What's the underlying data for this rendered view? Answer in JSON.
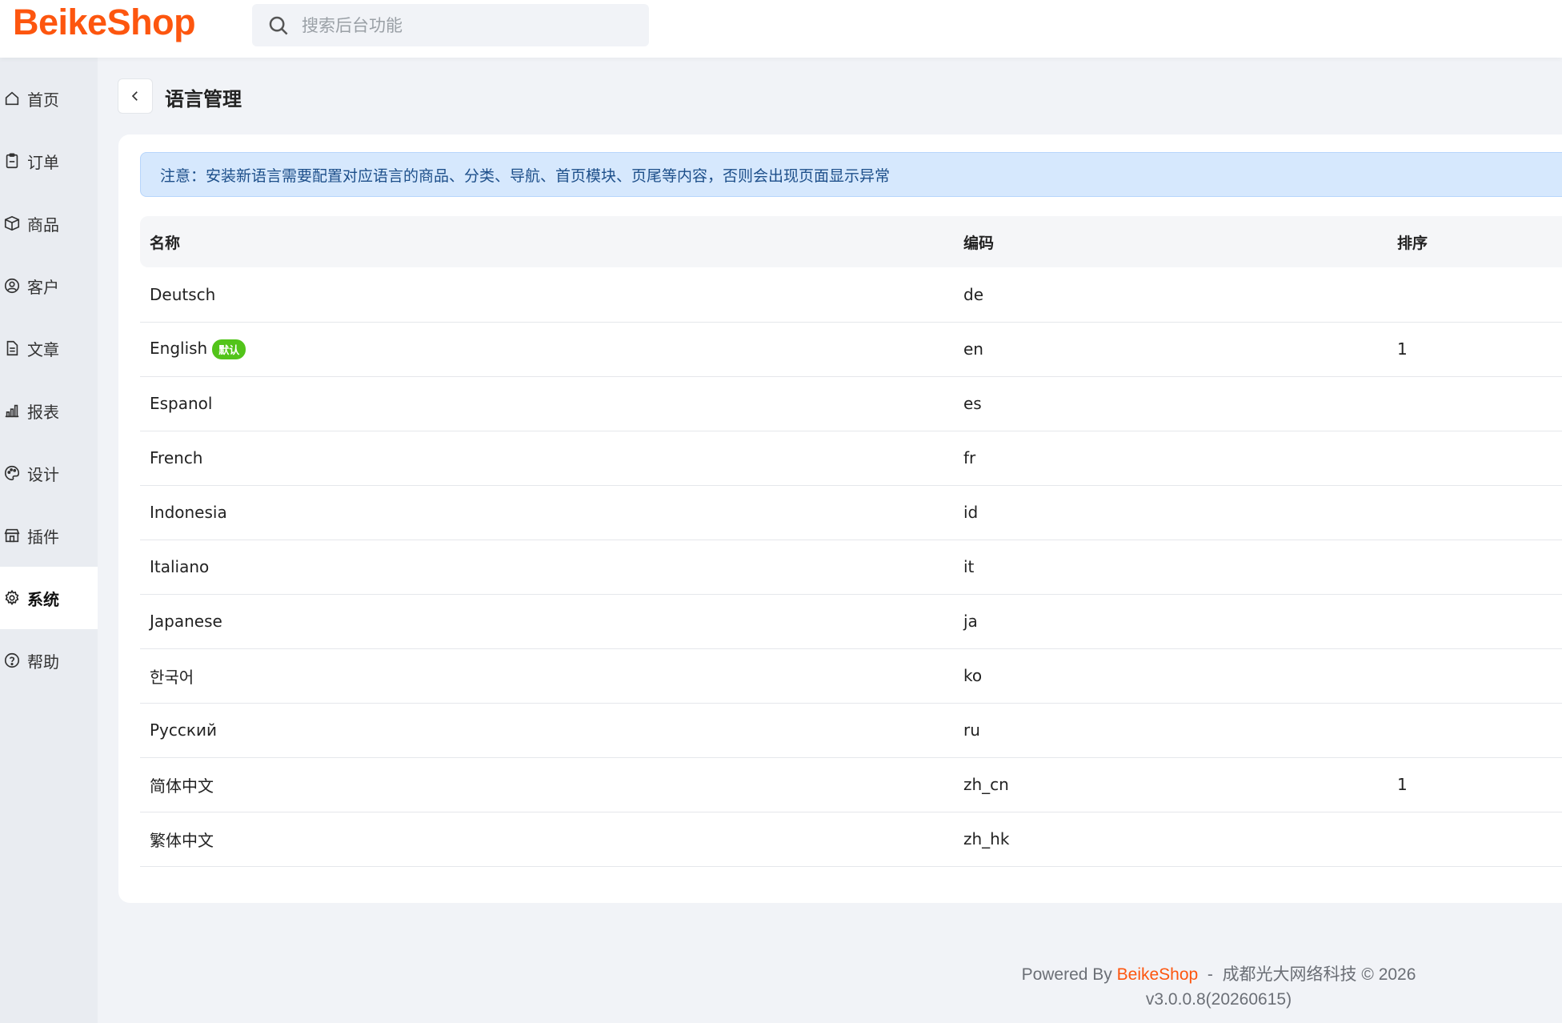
{
  "app": {
    "logo": "BeikeShop",
    "search_placeholder": "搜索后台功能"
  },
  "sidebar": {
    "items": [
      {
        "label": "首页",
        "icon": "home-icon"
      },
      {
        "label": "订单",
        "icon": "clipboard-icon"
      },
      {
        "label": "商品",
        "icon": "box-icon"
      },
      {
        "label": "客户",
        "icon": "user-circle-icon"
      },
      {
        "label": "文章",
        "icon": "document-icon"
      },
      {
        "label": "报表",
        "icon": "bar-chart-icon"
      },
      {
        "label": "设计",
        "icon": "palette-icon"
      },
      {
        "label": "插件",
        "icon": "store-icon"
      },
      {
        "label": "系统",
        "icon": "gear-icon",
        "active": true
      },
      {
        "label": "帮助",
        "icon": "question-circle-icon"
      }
    ]
  },
  "page": {
    "title": "语言管理",
    "notice": "注意：安装新语言需要配置对应语言的商品、分类、导航、首页模块、页尾等内容，否则会出现页面显示异常"
  },
  "table": {
    "headers": {
      "name": "名称",
      "code": "编码",
      "sort": "排序"
    },
    "default_badge": "默认",
    "rows": [
      {
        "name": "Deutsch",
        "code": "de",
        "sort": ""
      },
      {
        "name": "English",
        "code": "en",
        "sort": "1",
        "default": true
      },
      {
        "name": "Espanol",
        "code": "es",
        "sort": ""
      },
      {
        "name": "French",
        "code": "fr",
        "sort": ""
      },
      {
        "name": "Indonesia",
        "code": "id",
        "sort": ""
      },
      {
        "name": "Italiano",
        "code": "it",
        "sort": ""
      },
      {
        "name": "Japanese",
        "code": "ja",
        "sort": ""
      },
      {
        "name": "한국어",
        "code": "ko",
        "sort": ""
      },
      {
        "name": "Русский",
        "code": "ru",
        "sort": ""
      },
      {
        "name": "简体中文",
        "code": "zh_cn",
        "sort": "1"
      },
      {
        "name": "繁体中文",
        "code": "zh_hk",
        "sort": ""
      }
    ]
  },
  "footer": {
    "powered_by": "Powered By",
    "brand": "BeikeShop",
    "separator": "-",
    "company": "成都光大网络科技 © 2026",
    "version": "v3.0.0.8(20260615)"
  },
  "colors": {
    "brand": "#fd560f",
    "badge": "#52c41a",
    "alert_bg": "#d6e8fd"
  }
}
